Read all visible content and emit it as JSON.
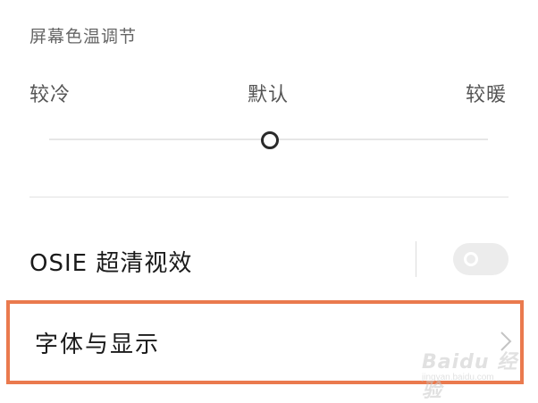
{
  "color_temp": {
    "title": "屏幕色温调节",
    "label_cool": "较冷",
    "label_default": "默认",
    "label_warm": "较暖",
    "slider_value": 0.5
  },
  "osie": {
    "label": "OSIE 超清视效",
    "enabled": false
  },
  "font_display": {
    "label": "字体与显示",
    "highlight_color": "#ea7a4e"
  },
  "icons": {
    "toggle_knob": "toggle-knob-icon",
    "chevron": "chevron-right-icon"
  },
  "watermark": {
    "brand": "Baidu 经验",
    "site": "jingyan.baidu.com"
  }
}
